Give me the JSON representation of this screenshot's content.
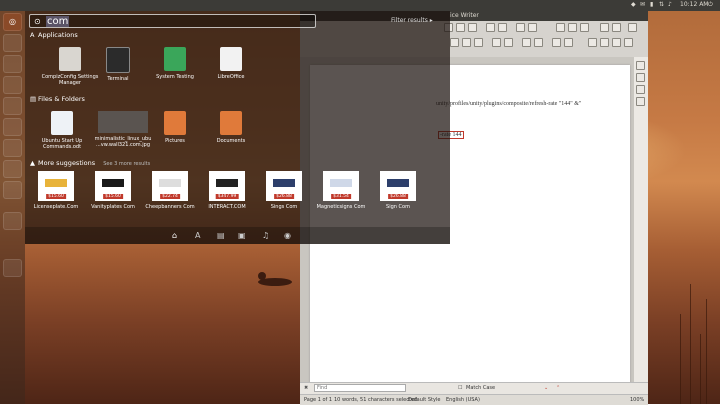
{
  "panel": {
    "clock": "10:12 AM",
    "icons": [
      "dropbox-icon",
      "mail-icon",
      "battery-icon",
      "network-icon",
      "volume-icon",
      "power-icon"
    ]
  },
  "launcher": {
    "items": [
      "ubuntu-logo-icon",
      "home-folder-icon",
      "firefox-icon",
      "writer-icon",
      "calc-icon",
      "impress-icon",
      "software-center-icon",
      "settings-icon",
      "workspace-icon",
      "terminal-icon",
      "trash-icon"
    ]
  },
  "dash": {
    "search_value": "com",
    "filter_label": "Filter results",
    "filter_arrow": "▸",
    "applications": {
      "heading": "Applications",
      "items": [
        {
          "label": "CompizConfig Settings Manager",
          "icon": "compizconfig-icon"
        },
        {
          "label": "Terminal",
          "icon": "terminal-icon"
        },
        {
          "label": "System Testing",
          "icon": "system-testing-icon"
        },
        {
          "label": "LibreOffice",
          "icon": "libreoffice-icon"
        }
      ]
    },
    "files": {
      "heading": "Files & Folders",
      "items": [
        {
          "label": "Ubuntu Start Up Commands.odt",
          "icon": "odt-file-icon"
        },
        {
          "label": "minimalistic_linux_ubu ...vw.wall321.com.jpg",
          "icon": "image-file-icon"
        },
        {
          "label": "Pictures",
          "icon": "pictures-folder-icon"
        },
        {
          "label": "Documents",
          "icon": "documents-folder-icon"
        }
      ]
    },
    "suggestions": {
      "heading": "More suggestions",
      "more_link": "See 3 more results",
      "items": [
        {
          "label": "Licenseplate.Com",
          "price": "$15.60"
        },
        {
          "label": "Vanityplates Com",
          "price": "$15.60"
        },
        {
          "label": "Cheepbanners Com",
          "price": "$22.74"
        },
        {
          "label": "INTERACT.COM",
          "price": "$347.99"
        },
        {
          "label": "Sings Com",
          "price": "$26.88"
        },
        {
          "label": "Magneticsigns Com",
          "price": "$31.54"
        },
        {
          "label": "Sign Com",
          "price": "$26.88"
        }
      ]
    },
    "lenses": [
      "home-lens-icon",
      "applications-lens-icon",
      "files-lens-icon",
      "video-lens-icon",
      "music-lens-icon",
      "photo-lens-icon"
    ]
  },
  "writer": {
    "title": "ice Writer",
    "doc_lines": [
      "unity/profiles/unity/plugins/composite/refresh-rate \"144\" &\"",
      "-rate 144"
    ],
    "find": {
      "placeholder": "Find",
      "match_case": "Match Case"
    },
    "status": {
      "page": "Page 1 of 1",
      "words": "10 words, 51 characters selected",
      "style": "Default Style",
      "language": "English (USA)",
      "zoom": "100%"
    }
  }
}
